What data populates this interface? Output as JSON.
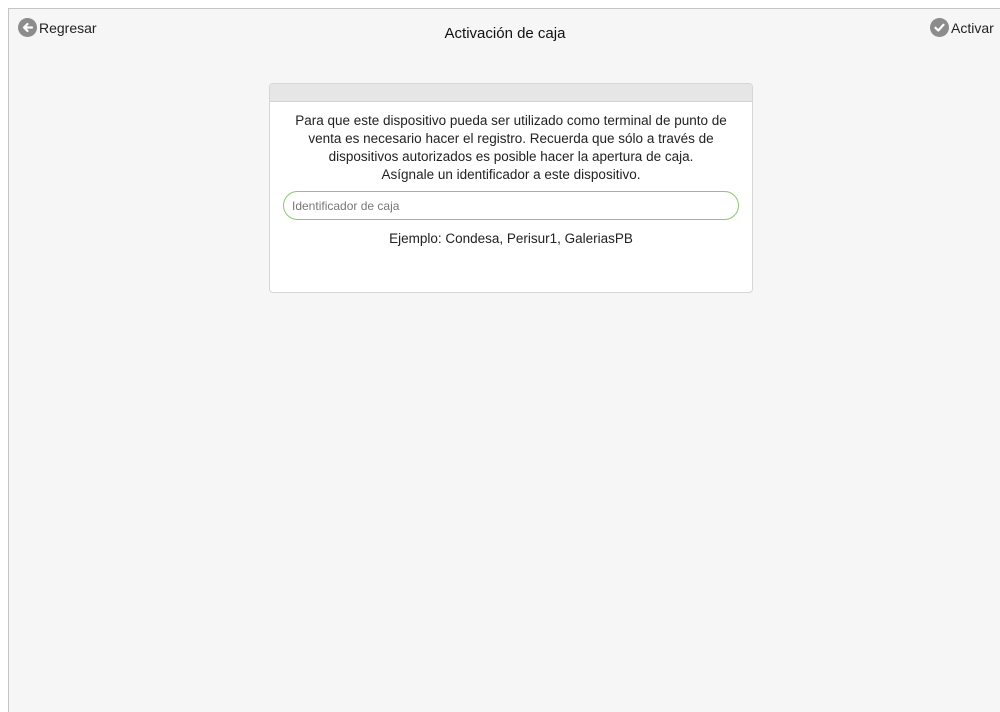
{
  "header": {
    "back_label": "Regresar",
    "title": "Activación de caja",
    "activate_label": "Activar"
  },
  "card": {
    "message": "Para que este dispositivo pueda ser utilizado como terminal de punto de venta es necesario hacer el registro. Recuerda que sólo a través de dispositivos autorizados es posible hacer la apertura de caja.",
    "instruction": "Asígnale un identificador a este dispositivo.",
    "input_placeholder": "Identificador de caja",
    "input_value": "",
    "example": "Ejemplo: Condesa, Perisur1, GaleriasPB"
  },
  "icons": {
    "back": "arrow-left-circle-icon",
    "activate": "check-circle-icon"
  },
  "colors": {
    "input_border": "#8cc870",
    "icon_fill": "#8c8c8c",
    "background": "#f6f6f6"
  }
}
